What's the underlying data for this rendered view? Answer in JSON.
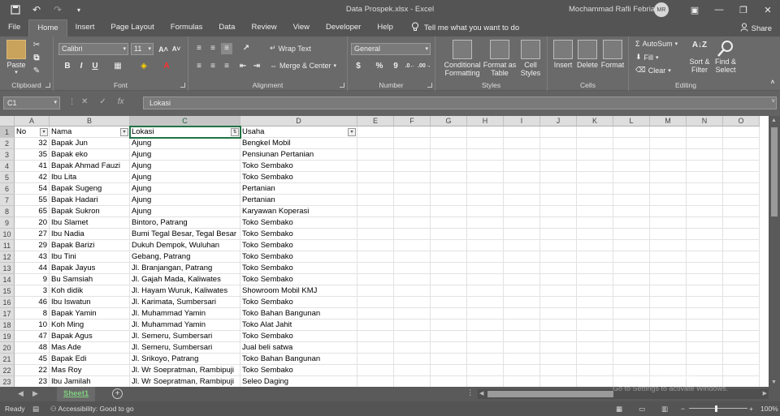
{
  "window": {
    "title": "Data Prospek.xlsx  -  Excel",
    "user": "Mochammad Rafli Febrian",
    "avatar_initials": "MR"
  },
  "tabs": [
    "File",
    "Home",
    "Insert",
    "Page Layout",
    "Formulas",
    "Data",
    "Review",
    "View",
    "Developer",
    "Help"
  ],
  "active_tab": "Home",
  "tellme": "Tell me what you want to do",
  "share": "Share",
  "ribbon": {
    "clipboard": {
      "label": "Clipboard",
      "paste": "Paste"
    },
    "font": {
      "label": "Font",
      "name": "Calibri",
      "size": "11",
      "bold": "B",
      "italic": "I",
      "underline": "U"
    },
    "alignment": {
      "label": "Alignment",
      "wrap": "Wrap Text",
      "merge": "Merge & Center"
    },
    "number": {
      "label": "Number",
      "format": "General",
      "percent": "%",
      "comma": "9"
    },
    "styles": {
      "label": "Styles",
      "conditional": "Conditional Formatting",
      "format_table": "Format as Table",
      "cell_styles": "Cell Styles"
    },
    "cells": {
      "label": "Cells",
      "insert": "Insert",
      "delete": "Delete",
      "format": "Format"
    },
    "editing": {
      "label": "Editing",
      "autosum": "AutoSum",
      "fill": "Fill",
      "clear": "Clear",
      "sort": "Sort & Filter",
      "find": "Find & Select"
    }
  },
  "formula_bar": {
    "name_box": "C1",
    "content": "Lokasi"
  },
  "columns": [
    "A",
    "B",
    "C",
    "D",
    "E",
    "F",
    "G",
    "H",
    "I",
    "J",
    "K",
    "L",
    "M",
    "N",
    "O"
  ],
  "headers": [
    "No",
    "Nama",
    "Lokasi",
    "Usaha"
  ],
  "rows": [
    {
      "r": "2",
      "no": "32",
      "nama": "Bapak Jun",
      "lokasi": "Ajung",
      "usaha": "Bengkel Mobil"
    },
    {
      "r": "3",
      "no": "35",
      "nama": "Bapak eko",
      "lokasi": "Ajung",
      "usaha": "Pensiunan Pertanian"
    },
    {
      "r": "4",
      "no": "41",
      "nama": "Bapak Ahmad Fauzi",
      "lokasi": "Ajung",
      "usaha": "Toko Sembako"
    },
    {
      "r": "5",
      "no": "42",
      "nama": "Ibu Lita",
      "lokasi": "Ajung",
      "usaha": "Toko Sembako"
    },
    {
      "r": "6",
      "no": "54",
      "nama": "Bapak Sugeng",
      "lokasi": "Ajung",
      "usaha": "Pertanian"
    },
    {
      "r": "7",
      "no": "55",
      "nama": "Bapak Hadari",
      "lokasi": "Ajung",
      "usaha": "Pertanian"
    },
    {
      "r": "8",
      "no": "65",
      "nama": "Bapak Sukron",
      "lokasi": "Ajung",
      "usaha": "Karyawan Koperasi"
    },
    {
      "r": "9",
      "no": "20",
      "nama": "Ibu Slamet",
      "lokasi": "Bintoro, Patrang",
      "usaha": "Toko Sembako"
    },
    {
      "r": "10",
      "no": "27",
      "nama": "Ibu Nadia",
      "lokasi": "Bumi Tegal Besar, Tegal Besar",
      "usaha": "Toko Sembako"
    },
    {
      "r": "11",
      "no": "29",
      "nama": "Bapak Barizi",
      "lokasi": "Dukuh Dempok, Wuluhan",
      "usaha": "Toko Sembako"
    },
    {
      "r": "12",
      "no": "43",
      "nama": "Ibu Tini",
      "lokasi": "Gebang, Patrang",
      "usaha": "Toko Sembako"
    },
    {
      "r": "13",
      "no": "44",
      "nama": "Bapak Jayus",
      "lokasi": "Jl. Branjangan, Patrang",
      "usaha": "Toko Sembako"
    },
    {
      "r": "14",
      "no": "9",
      "nama": "Bu Samsiah",
      "lokasi": "Jl. Gajah Mada, Kaliwates",
      "usaha": "Toko Sembako"
    },
    {
      "r": "15",
      "no": "3",
      "nama": "Koh didik",
      "lokasi": "Jl. Hayam Wuruk, Kaliwates",
      "usaha": "Showroom Mobil KMJ"
    },
    {
      "r": "16",
      "no": "46",
      "nama": "Ibu Iswatun",
      "lokasi": "Jl. Karimata, Sumbersari",
      "usaha": "Toko Sembako"
    },
    {
      "r": "17",
      "no": "8",
      "nama": "Bapak Yamin",
      "lokasi": "Jl. Muhammad Yamin",
      "usaha": "Toko Bahan Bangunan"
    },
    {
      "r": "18",
      "no": "10",
      "nama": "Koh Ming",
      "lokasi": "Jl. Muhammad Yamin",
      "usaha": "Toko Alat Jahit"
    },
    {
      "r": "19",
      "no": "47",
      "nama": "Bapak Agus",
      "lokasi": "Jl. Semeru, Sumbersari",
      "usaha": "Toko Sembako"
    },
    {
      "r": "20",
      "no": "48",
      "nama": "Mas Ade",
      "lokasi": "Jl. Semeru, Sumbersari",
      "usaha": "Jual beli satwa"
    },
    {
      "r": "21",
      "no": "45",
      "nama": "Bapak Edi",
      "lokasi": "Jl. Srikoyo, Patrang",
      "usaha": "Toko Bahan Bangunan"
    },
    {
      "r": "22",
      "no": "22",
      "nama": "Mas Roy",
      "lokasi": "Jl. Wr Soepratman, Rambipuji",
      "usaha": "Toko Sembako"
    },
    {
      "r": "23",
      "no": "23",
      "nama": "Ibu Jamilah",
      "lokasi": "Jl. Wr Soepratman, Rambipuji",
      "usaha": "Seleo Daging"
    }
  ],
  "sheet_tab": "Sheet1",
  "status": {
    "ready": "Ready",
    "accessibility": "Accessibility: Good to go",
    "zoom": "100%"
  },
  "watermark": {
    "line1": "Activate Windows",
    "line2": "Go to Settings to activate Windows."
  }
}
